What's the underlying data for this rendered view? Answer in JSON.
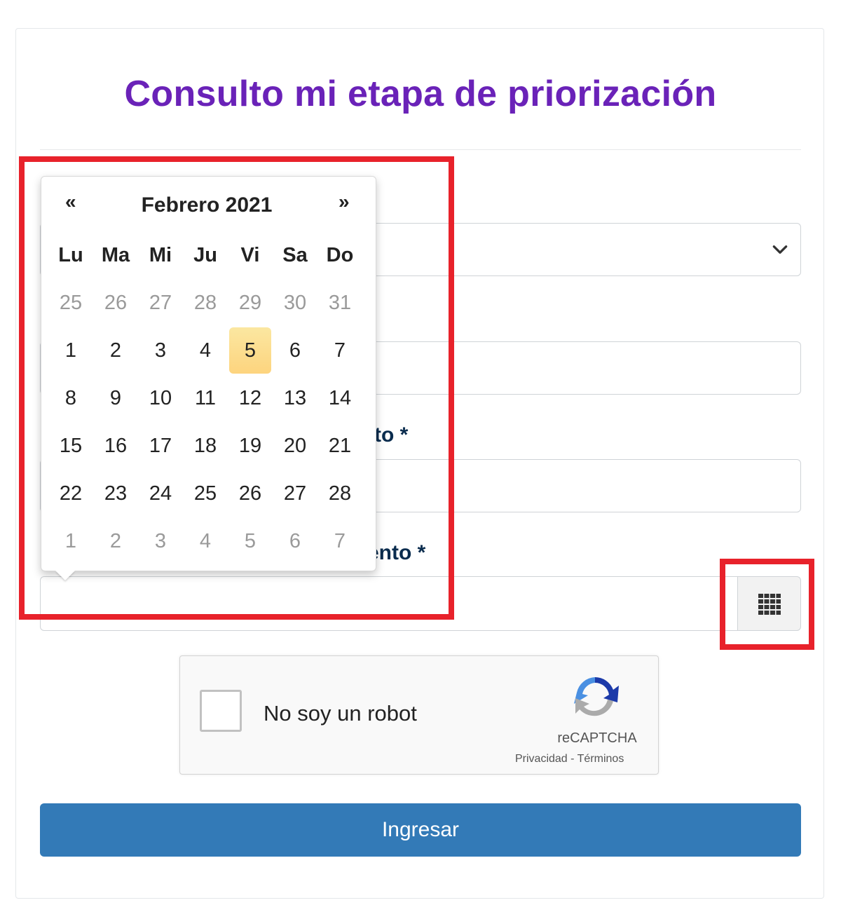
{
  "page_title": "Consulto mi etapa de priorización",
  "form": {
    "field3_label_partial": "to *",
    "field4_label_partial": "ento *",
    "submit_label": "Ingresar"
  },
  "datepicker": {
    "prev": "«",
    "next": "»",
    "month_year": "Febrero 2021",
    "weekdays": [
      "Lu",
      "Ma",
      "Mi",
      "Ju",
      "Vi",
      "Sa",
      "Do"
    ],
    "weeks": [
      [
        {
          "d": "25",
          "old": true
        },
        {
          "d": "26",
          "old": true
        },
        {
          "d": "27",
          "old": true
        },
        {
          "d": "28",
          "old": true
        },
        {
          "d": "29",
          "old": true
        },
        {
          "d": "30",
          "old": true
        },
        {
          "d": "31",
          "old": true
        }
      ],
      [
        {
          "d": "1"
        },
        {
          "d": "2"
        },
        {
          "d": "3"
        },
        {
          "d": "4"
        },
        {
          "d": "5",
          "today": true
        },
        {
          "d": "6"
        },
        {
          "d": "7"
        }
      ],
      [
        {
          "d": "8"
        },
        {
          "d": "9"
        },
        {
          "d": "10"
        },
        {
          "d": "11"
        },
        {
          "d": "12"
        },
        {
          "d": "13"
        },
        {
          "d": "14"
        }
      ],
      [
        {
          "d": "15"
        },
        {
          "d": "16"
        },
        {
          "d": "17"
        },
        {
          "d": "18"
        },
        {
          "d": "19"
        },
        {
          "d": "20"
        },
        {
          "d": "21"
        }
      ],
      [
        {
          "d": "22"
        },
        {
          "d": "23"
        },
        {
          "d": "24"
        },
        {
          "d": "25"
        },
        {
          "d": "26"
        },
        {
          "d": "27"
        },
        {
          "d": "28"
        }
      ],
      [
        {
          "d": "1",
          "old": true
        },
        {
          "d": "2",
          "old": true
        },
        {
          "d": "3",
          "old": true
        },
        {
          "d": "4",
          "old": true
        },
        {
          "d": "5",
          "old": true
        },
        {
          "d": "6",
          "old": true
        },
        {
          "d": "7",
          "old": true
        }
      ]
    ]
  },
  "recaptcha": {
    "label": "No soy un robot",
    "brand": "reCAPTCHA",
    "privacy": "Privacidad",
    "separator": " - ",
    "terms": "Términos"
  },
  "colors": {
    "title": "#6a22b8",
    "label": "#0a2c4e",
    "submit_bg": "#337ab7",
    "highlight": "#e8222b",
    "today_bg": "#fdd47e"
  },
  "icons": {
    "select_arrow": "chevron-down-icon",
    "calendar_button": "grid-icon",
    "recaptcha_logo": "recaptcha-logo-icon"
  }
}
